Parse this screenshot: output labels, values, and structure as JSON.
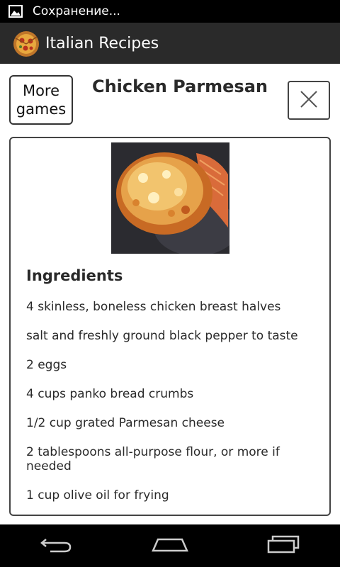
{
  "status_bar": {
    "notification_text": "Сохранение..."
  },
  "app_bar": {
    "title": "Italian Recipes",
    "icon": "pizza-icon"
  },
  "header": {
    "more_button_label": "More games",
    "recipe_title": "Chicken Parmesan",
    "close_icon": "close-icon"
  },
  "recipe": {
    "section_title": "Ingredients",
    "ingredients": [
      "4 skinless, boneless chicken breast halves",
      "salt and freshly ground black pepper to taste",
      "2 eggs",
      "4 cups panko bread crumbs",
      "1/2 cup grated Parmesan cheese",
      "2 tablespoons all-purpose flour, or more if needed",
      "1 cup olive oil for frying"
    ]
  },
  "nav_bar": {
    "icons": [
      "back-icon",
      "home-icon",
      "recents-icon"
    ]
  },
  "colors": {
    "status_bar": "#000000",
    "action_bar": "#2a2a2a",
    "text": "#2a2a2a",
    "border": "#444444"
  }
}
